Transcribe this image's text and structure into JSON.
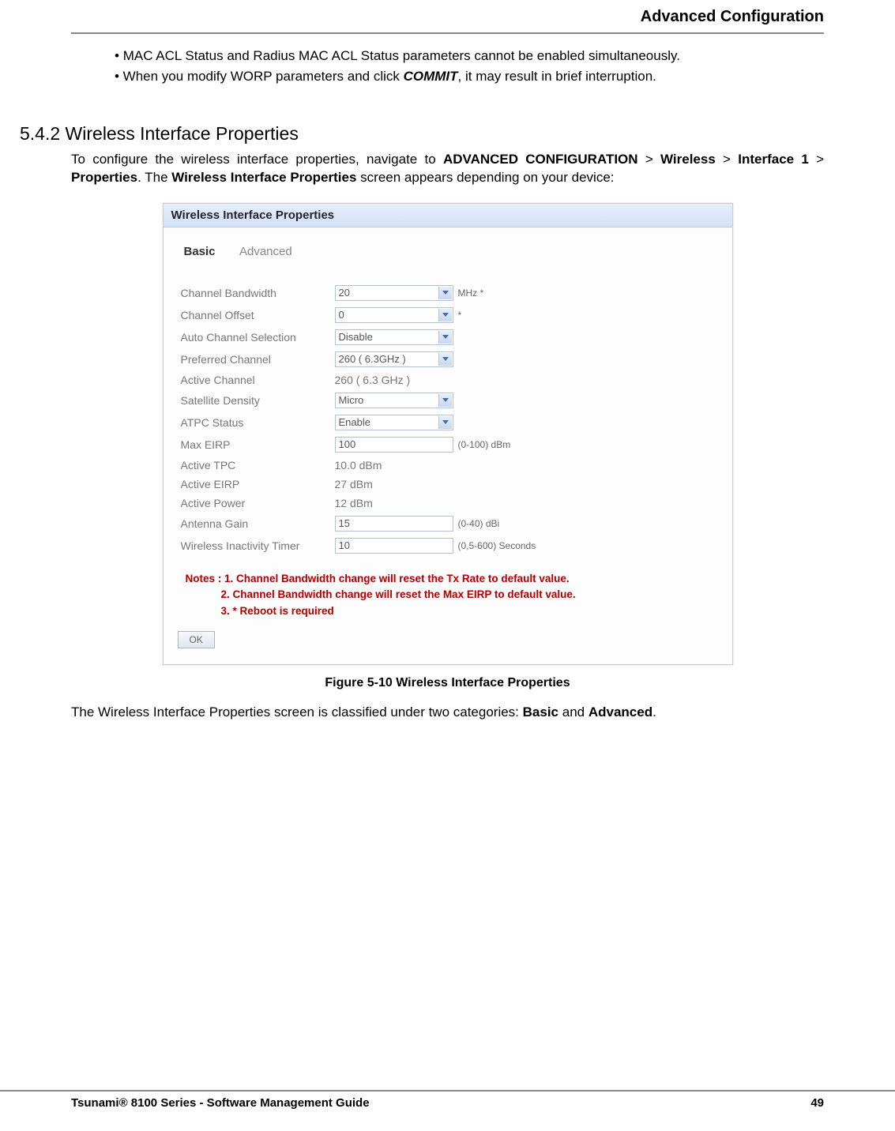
{
  "header": {
    "title": "Advanced Configuration"
  },
  "bullets": {
    "b1_prefix": "• ",
    "b1": "MAC ACL Status and Radius MAC ACL Status parameters cannot be enabled simultaneously.",
    "b2_a": "• When you modify WORP parameters and click ",
    "b2_strong": "COMMIT",
    "b2_b": ", it may result in brief interruption."
  },
  "section": {
    "number": "5.4.2",
    "title": "Wireless Interface Properties"
  },
  "intro": {
    "t1": "To configure the wireless interface properties, navigate to ",
    "t2": "ADVANCED CONFIGURATION",
    "t3": " > ",
    "t4": "Wireless",
    "t5": " > ",
    "t6": "Interface 1",
    "t7": " > ",
    "t8": "Properties",
    "t9": ". The ",
    "t10": "Wireless Interface Properties",
    "t11": " screen appears depending on your device:"
  },
  "wip": {
    "panel_title": "Wireless Interface Properties",
    "tabs": {
      "basic": "Basic",
      "advanced": "Advanced"
    },
    "rows": {
      "channel_bw": {
        "label": "Channel Bandwidth",
        "value": "20",
        "suffix": "MHz *"
      },
      "channel_offset": {
        "label": "Channel Offset",
        "value": "0",
        "suffix": "*"
      },
      "acs": {
        "label": "Auto Channel Selection",
        "value": "Disable"
      },
      "pref_channel": {
        "label": "Preferred Channel",
        "value": "260 ( 6.3GHz )"
      },
      "active_channel": {
        "label": "Active Channel",
        "value": "260  ( 6.3 GHz )"
      },
      "sat_density": {
        "label": "Satellite Density",
        "value": "Micro"
      },
      "atpc": {
        "label": "ATPC Status",
        "value": "Enable"
      },
      "max_eirp": {
        "label": "Max EIRP",
        "value": "100",
        "suffix": "(0-100) dBm"
      },
      "active_tpc": {
        "label": "Active TPC",
        "value": "10.0 dBm"
      },
      "active_eirp": {
        "label": "Active EIRP",
        "value": "27  dBm"
      },
      "active_power": {
        "label": "Active Power",
        "value": "12  dBm"
      },
      "ant_gain": {
        "label": "Antenna Gain",
        "value": "15",
        "suffix": "(0-40) dBi"
      },
      "inactivity": {
        "label": "Wireless Inactivity Timer",
        "value": "10",
        "suffix": "(0,5-600) Seconds"
      }
    },
    "notes": {
      "prefix": "Notes : ",
      "n1": "1. Channel Bandwidth change will reset the Tx Rate to default value.",
      "n2": "2. Channel Bandwidth change will reset the Max EIRP to default value.",
      "n3": "3. * Reboot is required"
    },
    "ok": "OK"
  },
  "figure_caption": "Figure 5-10 Wireless Interface Properties",
  "post": {
    "a": "The Wireless Interface Properties screen is classified under two categories: ",
    "b": "Basic",
    "c": " and ",
    "d": "Advanced",
    "e": "."
  },
  "footer": {
    "left": "Tsunami® 8100 Series - Software Management Guide",
    "right": "49"
  }
}
